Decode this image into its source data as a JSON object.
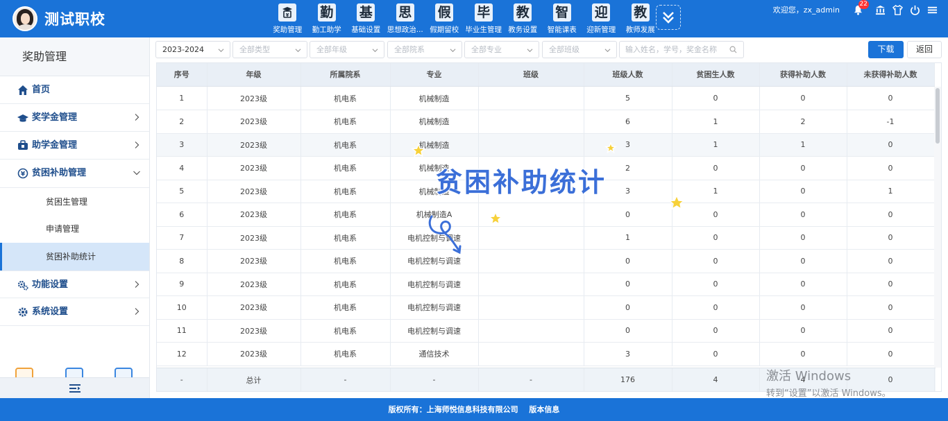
{
  "header": {
    "app_title": "测试职校",
    "nav": [
      {
        "glyph": "",
        "label": "奖助管理",
        "icon": "scholarship-icon"
      },
      {
        "glyph": "勤",
        "label": "勤工助学"
      },
      {
        "glyph": "基",
        "label": "基础设置"
      },
      {
        "glyph": "思",
        "label": "思想政治..."
      },
      {
        "glyph": "假",
        "label": "假期留校"
      },
      {
        "glyph": "毕",
        "label": "毕业生管理"
      },
      {
        "glyph": "教",
        "label": "教务设置"
      },
      {
        "glyph": "智",
        "label": "智能课表"
      },
      {
        "glyph": "迎",
        "label": "迎新管理"
      },
      {
        "glyph": "教",
        "label": "教师发展"
      }
    ],
    "welcome": "欢迎您，zx_admin",
    "notification_count": "22",
    "icons": [
      "bell-icon",
      "institution-icon",
      "shirt-icon",
      "power-icon",
      "menu-icon"
    ]
  },
  "sidebar": {
    "title": "奖助管理",
    "items": [
      {
        "label": "首页",
        "icon": "home-icon"
      },
      {
        "label": "奖学金管理",
        "icon": "graduation-cap-icon"
      },
      {
        "label": "助学金管理",
        "icon": "aid-icon"
      },
      {
        "label": "贫困补助管理",
        "icon": "subsidy-icon"
      },
      {
        "label": "功能设置",
        "icon": "gears-icon"
      },
      {
        "label": "系统设置",
        "icon": "gear-icon"
      }
    ],
    "subitems": [
      {
        "label": "贫困生管理"
      },
      {
        "label": "申请管理"
      },
      {
        "label": "贫困补助统计"
      }
    ]
  },
  "filters": {
    "year": "2023-2024",
    "type": "全部类型",
    "grade": "全部年级",
    "department": "全部院系",
    "major": "全部专业",
    "class": "全部班级",
    "search_placeholder": "输入姓名，学号，奖金名称",
    "download_label": "下载",
    "back_label": "返回"
  },
  "table": {
    "columns": [
      "序号",
      "年级",
      "所属院系",
      "专业",
      "班级",
      "班级人数",
      "贫困生人数",
      "获得补助人数",
      "未获得补助人数"
    ],
    "rows": [
      [
        "1",
        "2023级",
        "机电系",
        "机械制造",
        "",
        "5",
        "0",
        "0",
        "0"
      ],
      [
        "2",
        "2023级",
        "机电系",
        "机械制造",
        "",
        "6",
        "1",
        "2",
        "-1"
      ],
      [
        "3",
        "2023级",
        "机电系",
        "机械制造",
        "",
        "3",
        "1",
        "1",
        "0"
      ],
      [
        "4",
        "2023级",
        "机电系",
        "机械制造",
        "",
        "2",
        "0",
        "0",
        "0"
      ],
      [
        "5",
        "2023级",
        "机电系",
        "机械制造",
        "",
        "3",
        "1",
        "0",
        "1"
      ],
      [
        "6",
        "2023级",
        "机电系",
        "机械制造A",
        "",
        "0",
        "0",
        "0",
        "0"
      ],
      [
        "7",
        "2023级",
        "机电系",
        "电机控制与调速",
        "",
        "1",
        "0",
        "0",
        "0"
      ],
      [
        "8",
        "2023级",
        "机电系",
        "电机控制与调速",
        "",
        "0",
        "0",
        "0",
        "0"
      ],
      [
        "9",
        "2023级",
        "机电系",
        "电机控制与调速",
        "",
        "0",
        "0",
        "0",
        "0"
      ],
      [
        "10",
        "2023级",
        "机电系",
        "电机控制与调速",
        "",
        "0",
        "0",
        "0",
        "0"
      ],
      [
        "11",
        "2023级",
        "机电系",
        "电机控制与调速",
        "",
        "0",
        "0",
        "0",
        "0"
      ],
      [
        "12",
        "2023级",
        "机电系",
        "通信技术",
        "",
        "3",
        "0",
        "0",
        "0"
      ]
    ],
    "total": [
      "-",
      "总计",
      "-",
      "-",
      "-",
      "176",
      "4",
      "4",
      "0"
    ]
  },
  "overlay": {
    "sticker_text": "贫困补助统计",
    "windows_line1": "激活 Windows",
    "windows_line2": "转到“设置”以激活 Windows。"
  },
  "footer": {
    "copyright": "版权所有：上海师悦信息科技有限公司",
    "version": "版本信息"
  }
}
